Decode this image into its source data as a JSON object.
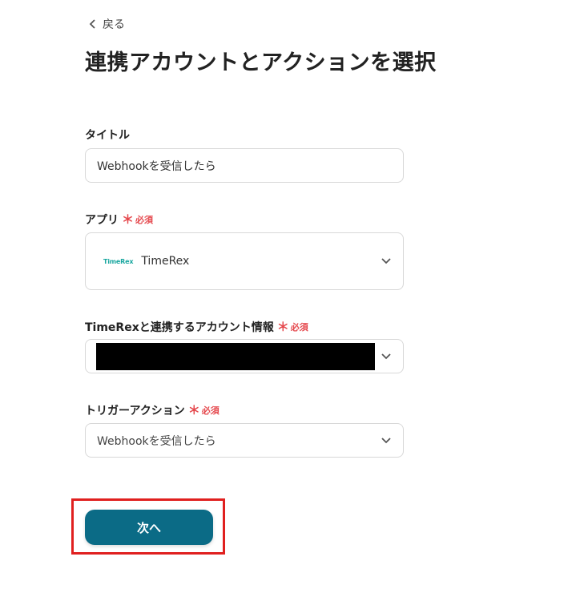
{
  "header": {
    "back_label": "戻る",
    "title": "連携アカウントとアクションを選択"
  },
  "form": {
    "title_field": {
      "label": "タイトル",
      "value": "Webhookを受信したら"
    },
    "app_field": {
      "label": "アプリ",
      "required_mark": "＊",
      "required_text": "必須",
      "logo_text": "TimeRex",
      "value": "TimeRex"
    },
    "account_field": {
      "label": "TimeRexと連携するアカウント情報",
      "required_mark": "＊",
      "required_text": "必須"
    },
    "trigger_field": {
      "label": "トリガーアクション",
      "required_mark": "＊",
      "required_text": "必須",
      "value": "Webhookを受信したら"
    }
  },
  "footer": {
    "next_label": "次へ"
  },
  "colors": {
    "primary": "#0b6b86",
    "required": "#e5484d",
    "highlight": "#e0201f",
    "redaction": "#000000"
  }
}
